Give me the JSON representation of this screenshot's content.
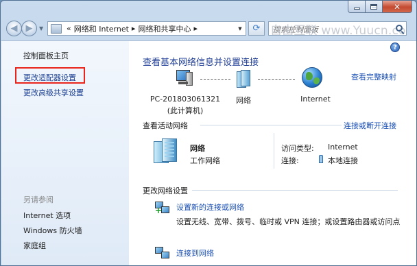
{
  "window": {
    "caption": {
      "minimize": "–",
      "maximize": "",
      "close": "✕"
    }
  },
  "nav": {
    "address_overflow": "«",
    "breadcrumb": [
      "网络和 Internet",
      "网络和共享中心"
    ],
    "separator": "▸",
    "search_placeholder": "搜索控制面板",
    "watermark": "自由互联 www.Yuucn.com"
  },
  "sidebar": {
    "home": "控制面板主页",
    "items": [
      "更改适配器设置",
      "更改高级共享设置"
    ],
    "see_also_title": "另请参阅",
    "see_also": [
      "Internet 选项",
      "Windows 防火墙",
      "家庭组"
    ]
  },
  "main": {
    "help": "?",
    "title": "查看基本网络信息并设置连接",
    "view_full_map": "查看完整映射",
    "map": {
      "computer_name": "PC-201803061321",
      "computer_sub": "(此计算机)",
      "network": "网络",
      "internet": "Internet"
    },
    "active_networks": {
      "label": "查看活动网络",
      "connect_link": "连接或断开连接",
      "network_name": "网络",
      "network_type": "工作网络",
      "access_type_label": "访问类型:",
      "access_type_value": "Internet",
      "connections_label": "连接:",
      "connections_value": "本地连接"
    },
    "change_settings": {
      "label": "更改网络设置",
      "tasks": [
        {
          "title": "设置新的连接或网络",
          "desc": "设置无线、宽带、拨号、临时或 VPN 连接；或设置路由器或访问点"
        },
        {
          "title": "连接到网络",
          "desc": ""
        }
      ]
    }
  }
}
